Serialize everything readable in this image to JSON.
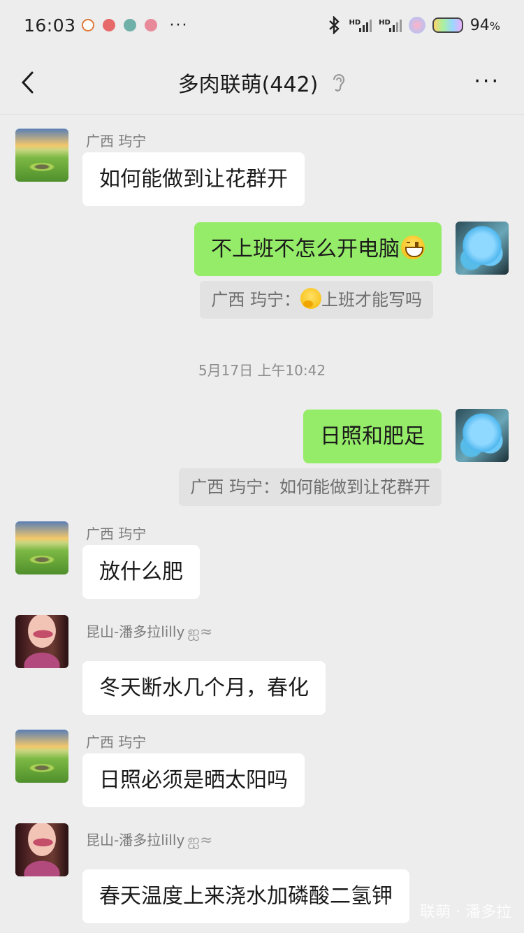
{
  "status_bar": {
    "time": "16:03",
    "battery_percent": "94",
    "percent_sign": "%",
    "more": "···",
    "hd": "HD"
  },
  "nav": {
    "title": "多肉联萌(442)",
    "more": "···"
  },
  "timestamps": [
    "5月17日 上午10:42"
  ],
  "messages": [
    {
      "side": "in",
      "sender": "广西 玙宁",
      "avatar": "landscape",
      "text": "如何能做到让花群开"
    },
    {
      "side": "out",
      "avatar": "blue",
      "text": "不上班不怎么开电脑",
      "emoji": "grinning-face",
      "quote_sender": "广西 玙宁：",
      "quote_emoji": "thinking-face",
      "quote_text": "上班才能写吗"
    },
    {
      "side": "out",
      "avatar": "blue",
      "text": "日照和肥足",
      "quote_sender": "广西 玙宁：",
      "quote_text": "如何能做到让花群开"
    },
    {
      "side": "in",
      "sender": "广西 玙宁",
      "avatar": "landscape",
      "text": "放什么肥"
    },
    {
      "side": "in",
      "sender": "昆山-潘多拉lilly",
      "sender_deco": "ஐ≈",
      "avatar": "woman",
      "text": "冬天断水几个月，春化"
    },
    {
      "side": "in",
      "sender": "广西 玙宁",
      "avatar": "landscape",
      "text": "日照必须是晒太阳吗"
    },
    {
      "side": "in",
      "sender": "昆山-潘多拉lilly",
      "sender_deco": "ஐ≈",
      "avatar": "woman",
      "text": "春天温度上来浇水加磷酸二氢钾"
    }
  ],
  "watermark": "联萌 · 潘多拉",
  "colors": {
    "background": "#ededed",
    "bubble_out": "#95ec69",
    "bubble_in": "#ffffff",
    "quote_bg": "#e2e2e2"
  }
}
